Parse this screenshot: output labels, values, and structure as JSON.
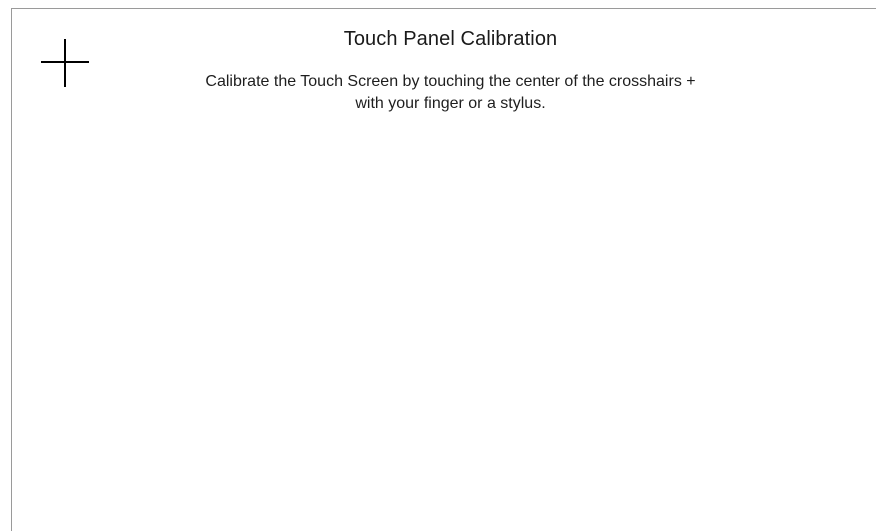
{
  "title": "Touch Panel Calibration",
  "instructions": {
    "line1": "Calibrate the Touch Screen by touching the center of the crosshairs +",
    "line2": "with your finger or a stylus."
  },
  "crosshair": {
    "icon": "crosshair-icon",
    "color": "#000000"
  },
  "colors": {
    "background": "#ffffff",
    "text": "#1a1a1a",
    "frame_border": "#9a9a9a"
  }
}
